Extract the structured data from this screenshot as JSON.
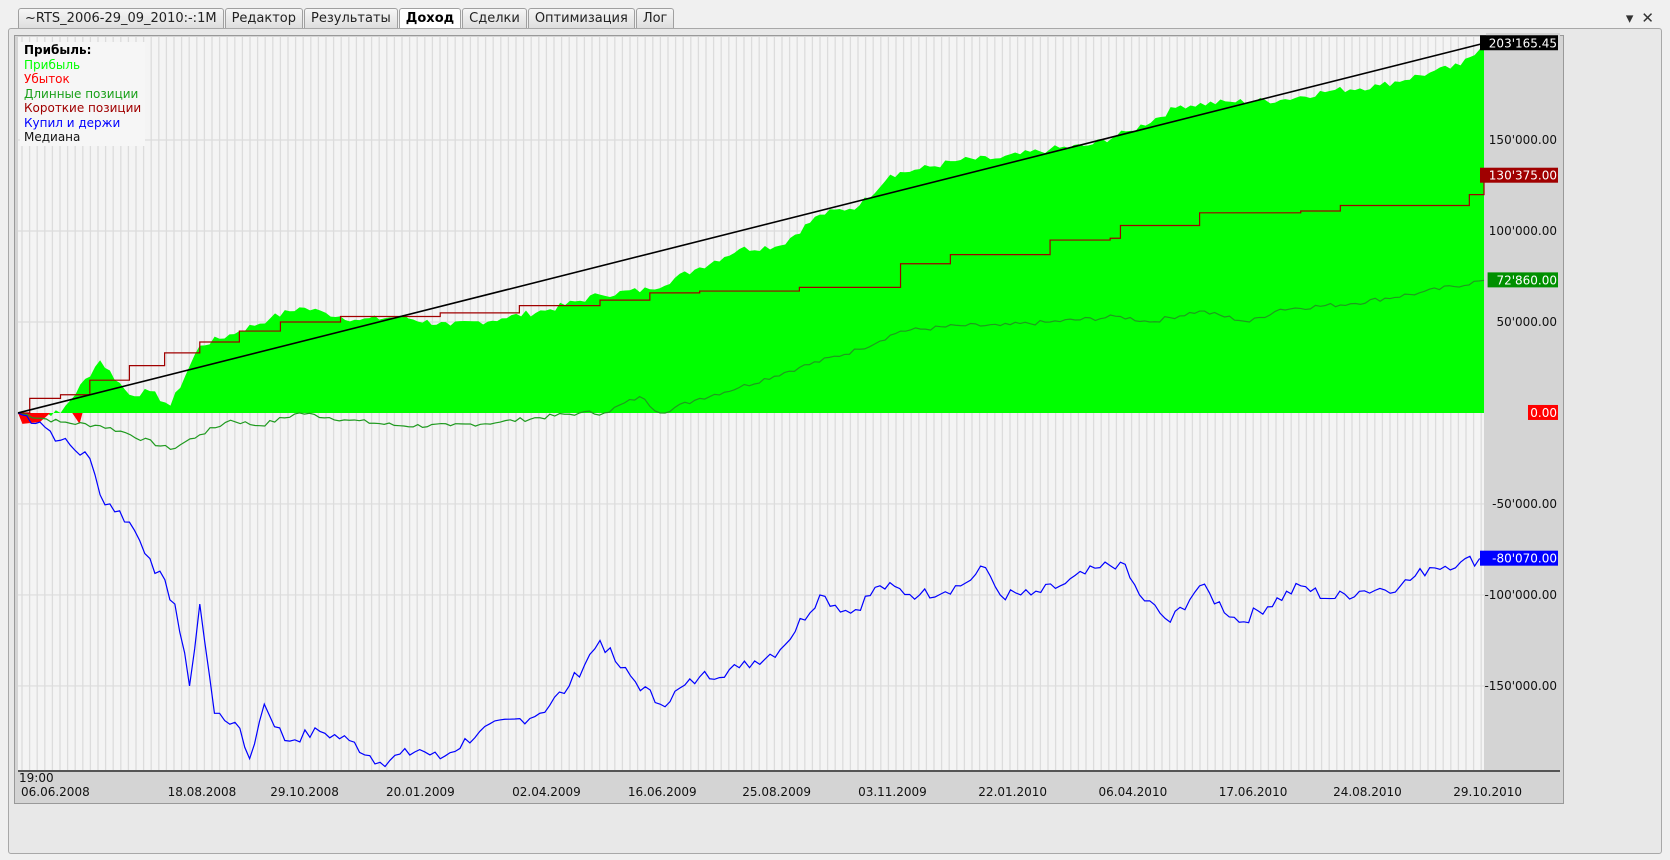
{
  "tabs": [
    {
      "label": "~RTS_2006-29_09_2010:-:1M",
      "active": false
    },
    {
      "label": "Редактор",
      "active": false
    },
    {
      "label": "Результаты",
      "active": false
    },
    {
      "label": "Доход",
      "active": true
    },
    {
      "label": "Сделки",
      "active": false
    },
    {
      "label": "Оптимизация",
      "active": false
    },
    {
      "label": "Лог",
      "active": false
    }
  ],
  "window_buttons": {
    "menu": "▾",
    "close": "✕"
  },
  "chart_data": {
    "type": "area",
    "title": "Прибыль:",
    "legend_placement": "top-left",
    "x_unit": "percent of timeline",
    "time_label": "19:00",
    "x_ticks": [
      {
        "t": 0,
        "label": "06.06.2008"
      },
      {
        "t": 10.0,
        "label": "18.08.2008"
      },
      {
        "t": 17.0,
        "label": "29.10.2008"
      },
      {
        "t": 24.9,
        "label": "20.01.2009"
      },
      {
        "t": 33.5,
        "label": "02.04.2009"
      },
      {
        "t": 41.4,
        "label": "16.06.2009"
      },
      {
        "t": 49.2,
        "label": "25.08.2009"
      },
      {
        "t": 57.1,
        "label": "03.11.2009"
      },
      {
        "t": 65.3,
        "label": "22.01.2010"
      },
      {
        "t": 73.5,
        "label": "06.04.2010"
      },
      {
        "t": 81.7,
        "label": "17.06.2010"
      },
      {
        "t": 89.5,
        "label": "24.08.2010"
      },
      {
        "t": 97.7,
        "label": "29.10.2010"
      }
    ],
    "ylim": [
      -196200,
      206600
    ],
    "y_ticks": [
      {
        "value": 150000,
        "label": "150'000.00"
      },
      {
        "value": 100000,
        "label": "100'000.00"
      },
      {
        "value": 50000,
        "label": "50'000.00"
      },
      {
        "value": -50000,
        "label": "-50'000.00"
      },
      {
        "value": -100000,
        "label": "-100'000.00"
      },
      {
        "value": -150000,
        "label": "-150'000.00"
      }
    ],
    "series": [
      {
        "name": "Прибыль",
        "kind": "area",
        "color": "#00ff00",
        "last_label": "203'165.45",
        "badge_color": "#000000",
        "badge_value": 203165.45,
        "points": [
          [
            0,
            0
          ],
          [
            2.9,
            0
          ],
          [
            5.6,
            29000
          ],
          [
            7.6,
            10000
          ],
          [
            9,
            12000
          ],
          [
            10.4,
            4000
          ],
          [
            12.4,
            37000
          ],
          [
            15.1,
            45000
          ],
          [
            17.2,
            52000
          ],
          [
            19.2,
            58000
          ],
          [
            21,
            55000
          ],
          [
            23.3,
            51000
          ],
          [
            26,
            53000
          ],
          [
            29.5,
            48000
          ],
          [
            33,
            52000
          ],
          [
            36.3,
            57000
          ],
          [
            39.7,
            65000
          ],
          [
            43.1,
            68000
          ],
          [
            46.5,
            80000
          ],
          [
            49.2,
            90000
          ],
          [
            52,
            92000
          ],
          [
            54.7,
            109000
          ],
          [
            57.4,
            114000
          ],
          [
            59.5,
            131000
          ],
          [
            61.5,
            134000
          ],
          [
            64.3,
            139000
          ],
          [
            67,
            140000
          ],
          [
            70.4,
            145000
          ],
          [
            73,
            147000
          ],
          [
            75.9,
            155000
          ],
          [
            79.3,
            169000
          ],
          [
            82.7,
            171000
          ],
          [
            86.1,
            172000
          ],
          [
            89.5,
            177000
          ],
          [
            92.9,
            180000
          ],
          [
            96.3,
            187000
          ],
          [
            98.4,
            191000
          ],
          [
            100,
            203165.45
          ]
        ]
      },
      {
        "name": "Убыток",
        "kind": "area",
        "color": "#ff0000",
        "points": [
          [
            0,
            0
          ],
          [
            0.3,
            -6000
          ],
          [
            1.5,
            -5000
          ],
          [
            2.2,
            0
          ],
          [
            3.7,
            0
          ],
          [
            4.2,
            -6000
          ],
          [
            4.4,
            0
          ]
        ]
      },
      {
        "name": "Длинные позиции",
        "kind": "line",
        "color": "#1f9a1f",
        "last_label": "72'860.00",
        "badge_color": "#009000",
        "badge_value": 72860,
        "points": [
          [
            0,
            0
          ],
          [
            2.9,
            -5000
          ],
          [
            5.6,
            -7000
          ],
          [
            7,
            -10000
          ],
          [
            10.4,
            -20000
          ],
          [
            12.4,
            -12000
          ],
          [
            14.5,
            -4000
          ],
          [
            16.5,
            -7000
          ],
          [
            19.2,
            0
          ],
          [
            22.6,
            -4000
          ],
          [
            26,
            -7000
          ],
          [
            29.5,
            -7000
          ],
          [
            32.9,
            -5000
          ],
          [
            38.3,
            0
          ],
          [
            40,
            0
          ],
          [
            42.4,
            9000
          ],
          [
            43.8,
            0
          ],
          [
            46.5,
            8000
          ],
          [
            49.2,
            14000
          ],
          [
            53.3,
            25000
          ],
          [
            57.4,
            35000
          ],
          [
            60.2,
            45000
          ],
          [
            64.3,
            48000
          ],
          [
            67,
            48000
          ],
          [
            70.4,
            50000
          ],
          [
            75.2,
            53000
          ],
          [
            77.2,
            50000
          ],
          [
            80.6,
            56000
          ],
          [
            84,
            50000
          ],
          [
            86.1,
            57000
          ],
          [
            90.9,
            60000
          ],
          [
            95.6,
            66000
          ],
          [
            100,
            72860
          ]
        ]
      },
      {
        "name": "Короткие позиции",
        "kind": "step",
        "color": "#a00000",
        "last_label": "130'375.00",
        "badge_color": "#a00000",
        "badge_value": 130375,
        "points": [
          [
            0,
            0
          ],
          [
            0.8,
            8000
          ],
          [
            2.9,
            10000
          ],
          [
            4.9,
            18000
          ],
          [
            7.6,
            26000
          ],
          [
            10,
            33000
          ],
          [
            12.4,
            39000
          ],
          [
            15.1,
            45000
          ],
          [
            17.9,
            50000
          ],
          [
            22,
            53000
          ],
          [
            28.8,
            55000
          ],
          [
            34.2,
            59000
          ],
          [
            39.7,
            62000
          ],
          [
            43.1,
            66000
          ],
          [
            46.5,
            67000
          ],
          [
            53.3,
            69000
          ],
          [
            60.2,
            82000
          ],
          [
            63.6,
            87000
          ],
          [
            70.4,
            95000
          ],
          [
            74.5,
            96000
          ],
          [
            75.2,
            103000
          ],
          [
            80.6,
            110000
          ],
          [
            87.5,
            111000
          ],
          [
            90.2,
            114000
          ],
          [
            97.7,
            114000
          ],
          [
            99,
            120000
          ],
          [
            100,
            130375
          ]
        ]
      },
      {
        "name": "Купил и держи",
        "kind": "line",
        "color": "#0000ff",
        "last_label": "-80'070.00",
        "badge_color": "#0000ff",
        "badge_value": -80070,
        "points": [
          [
            0,
            0
          ],
          [
            1.5,
            -5000
          ],
          [
            2.9,
            -15000
          ],
          [
            4.9,
            -25000
          ],
          [
            5.6,
            -45000
          ],
          [
            7.6,
            -60000
          ],
          [
            9,
            -80000
          ],
          [
            10.7,
            -105000
          ],
          [
            11.7,
            -150000
          ],
          [
            12.4,
            -105000
          ],
          [
            13.4,
            -165000
          ],
          [
            14.8,
            -170000
          ],
          [
            15.8,
            -190000
          ],
          [
            16.8,
            -160000
          ],
          [
            18.2,
            -180000
          ],
          [
            20.6,
            -175000
          ],
          [
            22.6,
            -180000
          ],
          [
            24.7,
            -192000
          ],
          [
            27.4,
            -185000
          ],
          [
            28.8,
            -190000
          ],
          [
            31.5,
            -175000
          ],
          [
            35.6,
            -165000
          ],
          [
            37.6,
            -150000
          ],
          [
            39.7,
            -125000
          ],
          [
            41.1,
            -140000
          ],
          [
            43.8,
            -160000
          ],
          [
            46.5,
            -145000
          ],
          [
            49.2,
            -140000
          ],
          [
            52,
            -130000
          ],
          [
            54.7,
            -100000
          ],
          [
            56.8,
            -110000
          ],
          [
            58.8,
            -95000
          ],
          [
            61.5,
            -100000
          ],
          [
            64.3,
            -95000
          ],
          [
            66,
            -85000
          ],
          [
            67,
            -100000
          ],
          [
            69.1,
            -100000
          ],
          [
            71.1,
            -95000
          ],
          [
            73.8,
            -85000
          ],
          [
            75.2,
            -82000
          ],
          [
            76.5,
            -100000
          ],
          [
            78.6,
            -115000
          ],
          [
            80.6,
            -95000
          ],
          [
            83.3,
            -115000
          ],
          [
            87.5,
            -95000
          ],
          [
            89.5,
            -102000
          ],
          [
            91.5,
            -98000
          ],
          [
            94.3,
            -95000
          ],
          [
            96.3,
            -85000
          ],
          [
            98.4,
            -82000
          ],
          [
            100,
            -80070
          ]
        ]
      },
      {
        "name": "Медиана",
        "kind": "line",
        "color": "#000000",
        "points": [
          [
            0,
            0
          ],
          [
            100,
            203165.45
          ]
        ]
      }
    ],
    "zero_badge": {
      "label": "0.00",
      "color": "#ff0000"
    }
  }
}
